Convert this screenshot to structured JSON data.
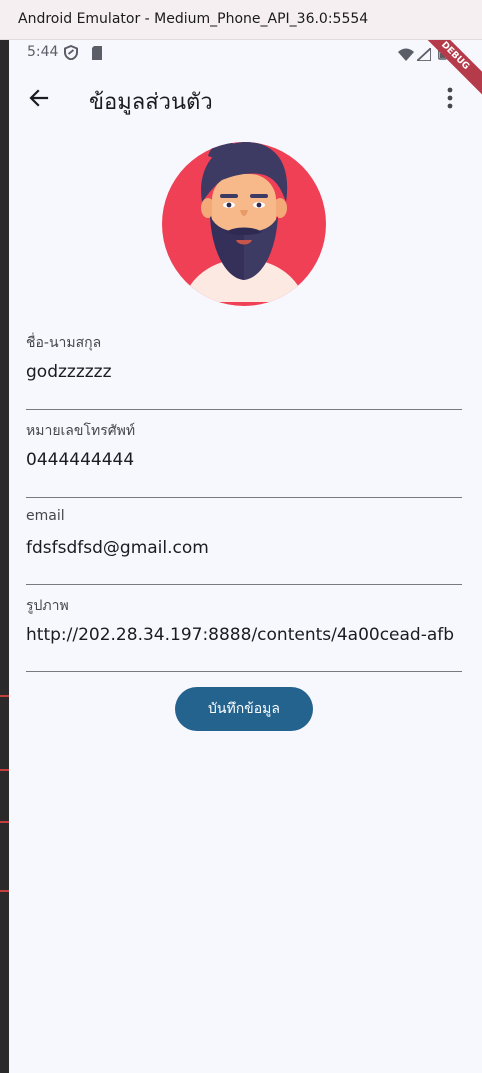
{
  "window": {
    "title": "Android Emulator - Medium_Phone_API_36.0:5554"
  },
  "status_bar": {
    "time": "5:44",
    "debug_banner": "DEBUG"
  },
  "app_bar": {
    "title": "ข้อมูลส่วนตัว"
  },
  "form": {
    "fields": [
      {
        "label": "ชื่อ-นามสกุล",
        "value": "godzzzzzz"
      },
      {
        "label": "หมายเลขโทรศัพท์",
        "value": "0444444444"
      },
      {
        "label": "email",
        "value": "fdsfsdfsd@gmail.com"
      },
      {
        "label": "รูปภาพ",
        "value": "http://202.28.34.197:8888/contents/4a00cead-afb"
      }
    ],
    "save_label": "บันทึกข้อมูล"
  },
  "colors": {
    "primary": "#24638e",
    "background": "#f7f8fd",
    "avatar_bg": "#f04055"
  },
  "icons": [
    "back-arrow-icon",
    "more-vert-icon",
    "shield-icon",
    "sd-card-icon",
    "wifi-icon",
    "signal-icon",
    "battery-icon"
  ]
}
